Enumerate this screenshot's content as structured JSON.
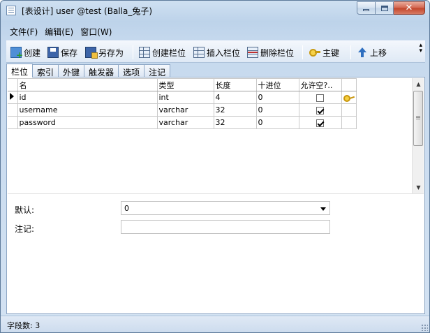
{
  "window": {
    "title": "[表设计] user @test (Balla_兔子)",
    "controls": {
      "minimize": "",
      "maximize": "",
      "close": "✕"
    }
  },
  "menu": [
    "文件(F)",
    "编辑(E)",
    "窗口(W)"
  ],
  "toolbar": {
    "create": "创建",
    "save": "保存",
    "save_as": "另存为",
    "create_field": "创建栏位",
    "insert_field": "插入栏位",
    "delete_field": "删除栏位",
    "primary_key": "主键",
    "move_up": "上移",
    "more": "▲\n▼"
  },
  "tabs": [
    "栏位",
    "索引",
    "外键",
    "触发器",
    "选项",
    "注记"
  ],
  "active_tab": "栏位",
  "grid": {
    "columns": [
      "名",
      "类型",
      "长度",
      "十进位",
      "允许空?..",
      ""
    ],
    "rows": [
      {
        "name": "id",
        "type": "int",
        "length": "4",
        "decimals": "0",
        "allow_null": false,
        "primary_key": true,
        "current": true
      },
      {
        "name": "username",
        "type": "varchar",
        "length": "32",
        "decimals": "0",
        "allow_null": true,
        "primary_key": false,
        "current": false
      },
      {
        "name": "password",
        "type": "varchar",
        "length": "32",
        "decimals": "0",
        "allow_null": true,
        "primary_key": false,
        "current": false
      }
    ]
  },
  "properties": {
    "default_label": "默认:",
    "default_value": "0",
    "comment_label": "注记:",
    "comment_value": ""
  },
  "status": {
    "field_count": "字段数: 3"
  },
  "colors": {
    "frame": "#bdd3ea",
    "close_button": "#c2442a",
    "key_gold": "#c8960e"
  }
}
